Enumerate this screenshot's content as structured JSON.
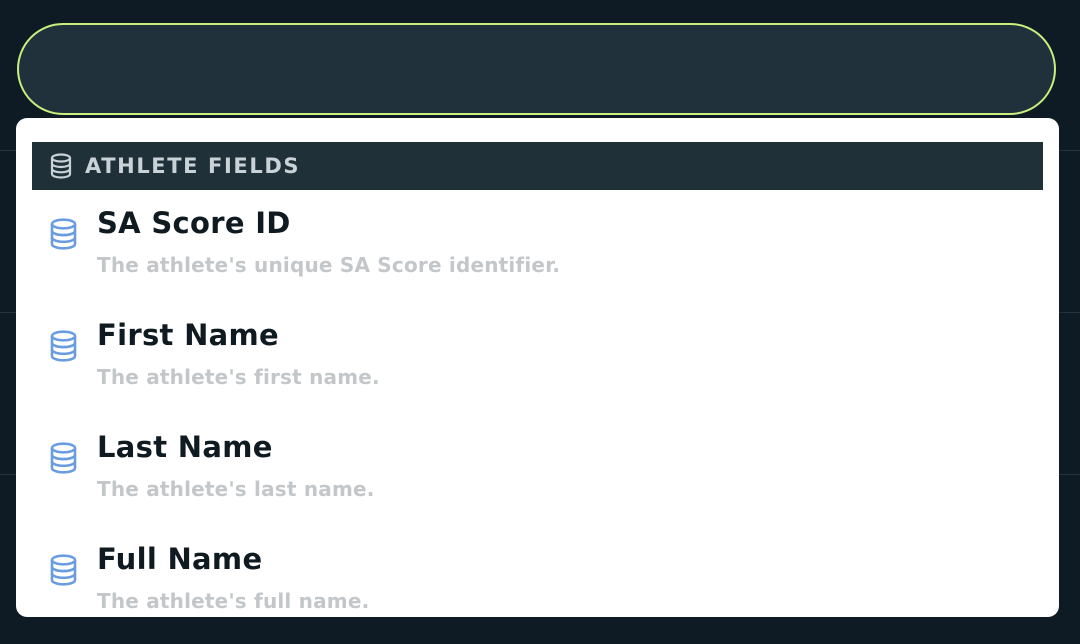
{
  "search": {
    "value": "",
    "placeholder": ""
  },
  "colors": {
    "background": "#0e1b24",
    "input_border": "#c9ef7e",
    "input_fill": "#21313c",
    "section_header": "#203039",
    "icon_accent": "#6a9de0"
  },
  "dropdown": {
    "section": {
      "icon": "database-icon",
      "title": "ATHLETE FIELDS"
    },
    "items": [
      {
        "icon": "database-icon",
        "label": "SA Score ID",
        "description": "The athlete's unique SA Score identifier."
      },
      {
        "icon": "database-icon",
        "label": "First Name",
        "description": "The athlete's first name."
      },
      {
        "icon": "database-icon",
        "label": "Last Name",
        "description": "The athlete's last name."
      },
      {
        "icon": "database-icon",
        "label": "Full Name",
        "description": "The athlete's full name."
      }
    ]
  }
}
